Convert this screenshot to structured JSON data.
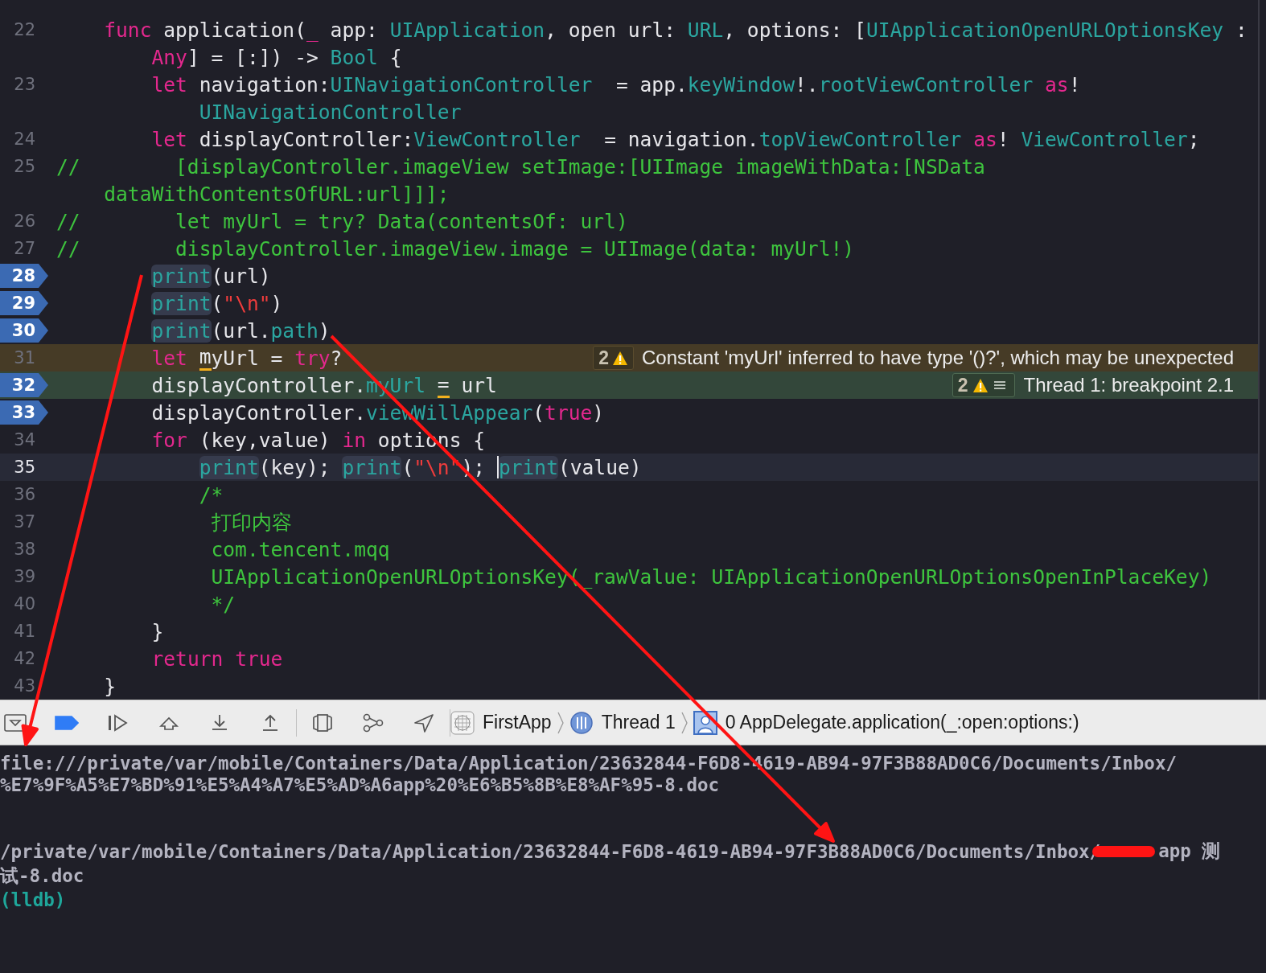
{
  "editor": {
    "lines": [
      {
        "number": "22",
        "breakpoint": false,
        "warning_line": false,
        "execution_line": false,
        "cursor_line": false,
        "tokens": [
          {
            "kind": "keyword",
            "text": "    func"
          },
          {
            "kind": "plain",
            "text": " application("
          },
          {
            "kind": "keyword",
            "text": "_"
          },
          {
            "kind": "plain",
            "text": " app: "
          },
          {
            "kind": "type",
            "text": "UIApplication"
          },
          {
            "kind": "plain",
            "text": ", open url: "
          },
          {
            "kind": "type",
            "text": "URL"
          },
          {
            "kind": "plain",
            "text": ", options: ["
          },
          {
            "kind": "type",
            "text": "UIApplicationOpenURLOptionsKey"
          },
          {
            "kind": "plain",
            "text": " :"
          }
        ],
        "continuation": {
          "tokens": [
            {
              "kind": "keyword",
              "text": "        Any"
            },
            {
              "kind": "plain",
              "text": "] = [:]) -> "
            },
            {
              "kind": "type",
              "text": "Bool"
            },
            {
              "kind": "plain",
              "text": " {"
            }
          ]
        }
      },
      {
        "number": "23",
        "breakpoint": false,
        "warning_line": false,
        "execution_line": false,
        "cursor_line": false,
        "tokens": [
          {
            "kind": "keyword",
            "text": "        let"
          },
          {
            "kind": "plain",
            "text": " navigation:"
          },
          {
            "kind": "type",
            "text": "UINavigationController"
          },
          {
            "kind": "plain",
            "text": "  = app."
          },
          {
            "kind": "type",
            "text": "keyWindow"
          },
          {
            "kind": "plain",
            "text": "!."
          },
          {
            "kind": "type",
            "text": "rootViewController"
          },
          {
            "kind": "keyword",
            "text": " as"
          },
          {
            "kind": "plain",
            "text": "!"
          }
        ],
        "continuation": {
          "tokens": [
            {
              "kind": "type",
              "text": "            UINavigationController"
            }
          ]
        }
      },
      {
        "number": "24",
        "breakpoint": false,
        "warning_line": false,
        "execution_line": false,
        "cursor_line": false,
        "tokens": [
          {
            "kind": "keyword",
            "text": "        let"
          },
          {
            "kind": "plain",
            "text": " displayController:"
          },
          {
            "kind": "type",
            "text": "ViewController"
          },
          {
            "kind": "plain",
            "text": "  = navigation."
          },
          {
            "kind": "type",
            "text": "topViewController"
          },
          {
            "kind": "keyword",
            "text": " as"
          },
          {
            "kind": "plain",
            "text": "! "
          },
          {
            "kind": "type",
            "text": "ViewController"
          },
          {
            "kind": "plain",
            "text": ";"
          }
        ]
      },
      {
        "number": "25",
        "breakpoint": false,
        "warning_line": false,
        "execution_line": false,
        "cursor_line": false,
        "tokens": [
          {
            "kind": "comment",
            "text": "//        [displayController.imageView setImage:[UIImage imageWithData:[NSData"
          }
        ],
        "continuation": {
          "tokens": [
            {
              "kind": "comment",
              "text": "    dataWithContentsOfURL:url]]];"
            }
          ]
        }
      },
      {
        "number": "26",
        "breakpoint": false,
        "warning_line": false,
        "execution_line": false,
        "cursor_line": false,
        "tokens": [
          {
            "kind": "comment",
            "text": "//        let myUrl = try? Data(contentsOf: url)"
          }
        ]
      },
      {
        "number": "27",
        "breakpoint": false,
        "warning_line": false,
        "execution_line": false,
        "cursor_line": false,
        "tokens": [
          {
            "kind": "comment",
            "text": "//        displayController.imageView.image = UIImage(data: myUrl!)"
          }
        ]
      },
      {
        "number": "28",
        "breakpoint": true,
        "warning_line": false,
        "execution_line": false,
        "cursor_line": false,
        "tokens": [
          {
            "kind": "call",
            "text": "        print"
          },
          {
            "kind": "plain",
            "text": "(url)"
          }
        ]
      },
      {
        "number": "29",
        "breakpoint": true,
        "warning_line": false,
        "execution_line": false,
        "cursor_line": false,
        "tokens": [
          {
            "kind": "call",
            "text": "        print"
          },
          {
            "kind": "plain",
            "text": "("
          },
          {
            "kind": "string",
            "text": "\"\\n\""
          },
          {
            "kind": "plain",
            "text": ")"
          }
        ]
      },
      {
        "number": "30",
        "breakpoint": true,
        "warning_line": false,
        "execution_line": false,
        "cursor_line": false,
        "tokens": [
          {
            "kind": "call",
            "text": "        print"
          },
          {
            "kind": "plain",
            "text": "(url."
          },
          {
            "kind": "type",
            "text": "path"
          },
          {
            "kind": "plain",
            "text": ")"
          }
        ]
      },
      {
        "number": "31",
        "breakpoint": false,
        "warning_line": true,
        "execution_line": false,
        "cursor_line": false,
        "tokens": [
          {
            "kind": "keyword",
            "text": "        let"
          },
          {
            "kind": "underlined",
            "text": " m"
          },
          {
            "kind": "plain",
            "text": "yUrl = "
          },
          {
            "kind": "keyword",
            "text": "try"
          },
          {
            "kind": "plain",
            "text": "?"
          }
        ],
        "annotation": {
          "kind": "warning",
          "count": "2",
          "message": "Constant 'myUrl' inferred to have type '()?', which may be unexpected"
        }
      },
      {
        "number": "32",
        "breakpoint": true,
        "warning_line": false,
        "execution_line": true,
        "cursor_line": false,
        "tokens": [
          {
            "kind": "plain",
            "text": "        displayController."
          },
          {
            "kind": "type",
            "text": "myUrl"
          },
          {
            "kind": "underlined",
            "text": " ="
          },
          {
            "kind": "plain",
            "text": " url"
          }
        ],
        "annotation": {
          "kind": "thread",
          "count": "2",
          "message": "Thread 1: breakpoint 2.1"
        }
      },
      {
        "number": "33",
        "breakpoint": true,
        "warning_line": false,
        "execution_line": false,
        "cursor_line": false,
        "tokens": [
          {
            "kind": "plain",
            "text": "        displayController."
          },
          {
            "kind": "type",
            "text": "viewWillAppear"
          },
          {
            "kind": "plain",
            "text": "("
          },
          {
            "kind": "keyword",
            "text": "true"
          },
          {
            "kind": "plain",
            "text": ")"
          }
        ]
      },
      {
        "number": "34",
        "breakpoint": false,
        "warning_line": false,
        "execution_line": false,
        "cursor_line": false,
        "tokens": [
          {
            "kind": "keyword",
            "text": "        for"
          },
          {
            "kind": "plain",
            "text": " (key,value) "
          },
          {
            "kind": "keyword",
            "text": "in"
          },
          {
            "kind": "plain",
            "text": " options {"
          }
        ]
      },
      {
        "number": "35",
        "breakpoint": false,
        "warning_line": false,
        "execution_line": false,
        "cursor_line": true,
        "tokens": [
          {
            "kind": "call",
            "text": "            print"
          },
          {
            "kind": "plain",
            "text": "(key); "
          },
          {
            "kind": "call",
            "text": "print"
          },
          {
            "kind": "plain",
            "text": "("
          },
          {
            "kind": "string",
            "text": "\"\\n\""
          },
          {
            "kind": "plain",
            "text": "); "
          },
          {
            "kind": "caret"
          },
          {
            "kind": "call",
            "text": "print"
          },
          {
            "kind": "plain",
            "text": "(value)"
          }
        ]
      },
      {
        "number": "36",
        "breakpoint": false,
        "warning_line": false,
        "execution_line": false,
        "cursor_line": false,
        "tokens": [
          {
            "kind": "comment",
            "text": "            /*"
          }
        ]
      },
      {
        "number": "37",
        "breakpoint": false,
        "warning_line": false,
        "execution_line": false,
        "cursor_line": false,
        "tokens": [
          {
            "kind": "comment",
            "text": "             打印内容"
          }
        ]
      },
      {
        "number": "38",
        "breakpoint": false,
        "warning_line": false,
        "execution_line": false,
        "cursor_line": false,
        "tokens": [
          {
            "kind": "comment",
            "text": "             com.tencent.mqq"
          }
        ]
      },
      {
        "number": "39",
        "breakpoint": false,
        "warning_line": false,
        "execution_line": false,
        "cursor_line": false,
        "tokens": [
          {
            "kind": "comment",
            "text": "             UIApplicationOpenURLOptionsKey(_rawValue: UIApplicationOpenURLOptionsOpenInPlaceKey)"
          }
        ]
      },
      {
        "number": "40",
        "breakpoint": false,
        "warning_line": false,
        "execution_line": false,
        "cursor_line": false,
        "tokens": [
          {
            "kind": "comment",
            "text": "             */"
          }
        ]
      },
      {
        "number": "41",
        "breakpoint": false,
        "warning_line": false,
        "execution_line": false,
        "cursor_line": false,
        "tokens": [
          {
            "kind": "plain",
            "text": "        }"
          }
        ]
      },
      {
        "number": "42",
        "breakpoint": false,
        "warning_line": false,
        "execution_line": false,
        "cursor_line": false,
        "tokens": [
          {
            "kind": "keyword",
            "text": "        return"
          },
          {
            "kind": "keyword",
            "text": " true"
          }
        ]
      },
      {
        "number": "43",
        "breakpoint": false,
        "warning_line": false,
        "execution_line": false,
        "cursor_line": false,
        "tokens": [
          {
            "kind": "plain",
            "text": "    }"
          }
        ]
      }
    ]
  },
  "debug_bar": {
    "buttons": [
      {
        "kind": "console-toggle"
      },
      {
        "kind": "breakpoints",
        "on": true
      },
      {
        "kind": "continue"
      },
      {
        "kind": "step-over"
      },
      {
        "kind": "step-into"
      },
      {
        "kind": "step-out"
      },
      {
        "kind": "divider"
      },
      {
        "kind": "view-debugger"
      },
      {
        "kind": "memory-graph"
      },
      {
        "kind": "location"
      },
      {
        "kind": "divider"
      }
    ],
    "breadcrumb": [
      {
        "kind": "app",
        "label": "FirstApp"
      },
      {
        "kind": "thread",
        "label": "Thread 1"
      },
      {
        "kind": "frame",
        "label": "0 AppDelegate.application(_:open:options:)"
      }
    ]
  },
  "console": {
    "entries": [
      {
        "kind": "output",
        "lines": [
          {
            "parts": [
              {
                "kind": "text",
                "text": "file:///private/var/mobile/Containers/Data/Application/23632844-F6D8-4619-AB94-97F3B88AD0C6/Documents/Inbox/"
              }
            ]
          },
          {
            "parts": [
              {
                "kind": "text",
                "text": "%E7%9F%A5%E7%BD%91%E5%A4%A7%E5%AD%A6app%20%E6%B5%8B%E8%AF%95-8.doc"
              }
            ]
          }
        ]
      },
      {
        "kind": "blank"
      },
      {
        "kind": "blank"
      },
      {
        "kind": "output",
        "lines": [
          {
            "parts": [
              {
                "kind": "text",
                "text": "/private/var/mobile/Containers/Data/Application/23632844-F6D8-4619-AB94-97F3B88AD0C6/Documents/Inbox/"
              },
              {
                "kind": "redaction"
              },
              {
                "kind": "text",
                "text": "app 测"
              }
            ]
          },
          {
            "parts": [
              {
                "kind": "text",
                "text": "试-8.doc"
              }
            ]
          }
        ]
      },
      {
        "kind": "prompt",
        "lines": [
          {
            "parts": [
              {
                "kind": "text",
                "text": "(lldb)"
              }
            ]
          }
        ]
      }
    ]
  },
  "annotations": [
    {
      "kind": "arrow"
    },
    {
      "kind": "arrow"
    }
  ]
}
